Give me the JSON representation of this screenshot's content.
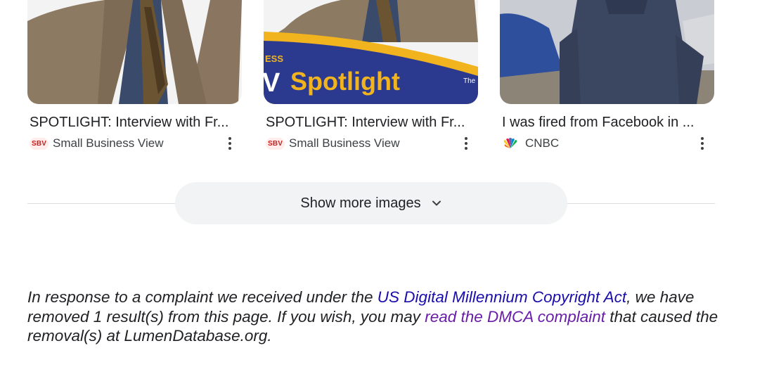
{
  "results": [
    {
      "caption": "SPOTLIGHT: Interview with Fr...",
      "source": "Small Business View",
      "favicon_text": "SBV",
      "favicon": "sbv-logo-icon",
      "thumb_icon": "man-in-suit-photo"
    },
    {
      "caption": "SPOTLIGHT: Interview with Fr...",
      "source": "Small Business View",
      "favicon_text": "SBV",
      "favicon": "sbv-logo-icon",
      "thumb_icon": "spotlight-banner-photo",
      "banner_text": "Spotlight",
      "banner_small_left": "ESS",
      "banner_small_right": "The",
      "banner_letter": "V"
    },
    {
      "caption": "I was fired from Facebook in ...",
      "source": "CNBC",
      "favicon": "cnbc-peacock-icon",
      "thumb_icon": "man-by-airplane-photo"
    }
  ],
  "show_more": {
    "label": "Show more images",
    "icon": "chevron-down-icon"
  },
  "dmca_notice": {
    "text_1": "In response to a complaint we received under the ",
    "link_1": "US Digital Millennium Copyright Act",
    "text_2": ", we have removed 1 result(s) from this page. If you wish, you may ",
    "link_2": "read the DMCA complaint",
    "text_3": " that caused the removal(s) at LumenDatabase.org."
  },
  "colors": {
    "link": "#1a0dab",
    "visited_link": "#681da8",
    "chip_bg": "#f1f3f4",
    "banner_blue": "#2b3a8f",
    "banner_gold": "#f2b41e"
  }
}
